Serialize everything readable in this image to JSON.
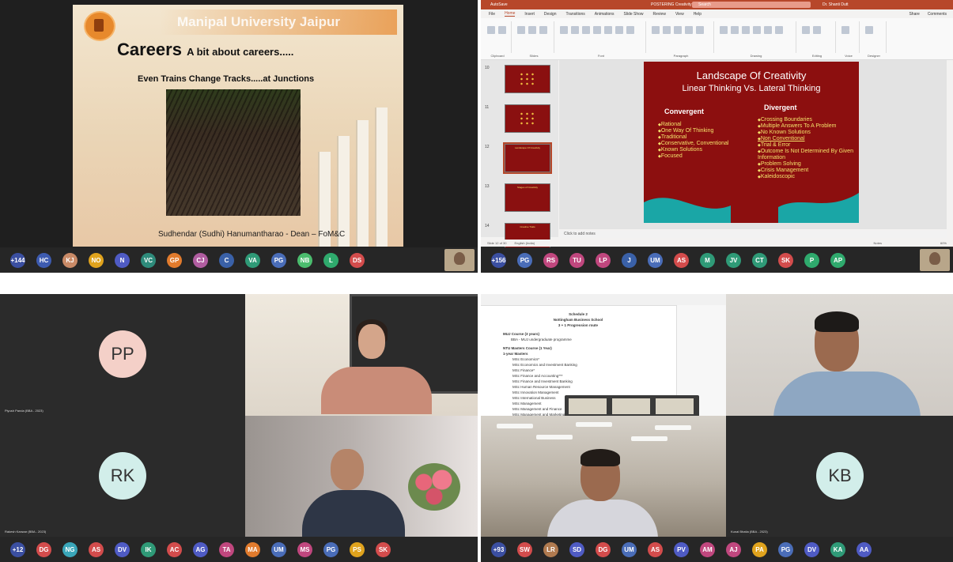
{
  "q1": {
    "slide": {
      "university": "Manipal University Jaipur",
      "careers": "Careers",
      "careers_sub": "A bit about careers.....",
      "tracks": "Even Trains Change Tracks.....at Junctions",
      "dean": "Sudhendar (Sudhi) Hanumantharao - Dean – FoM&C"
    },
    "strip": [
      {
        "initials": "+144",
        "color": "#3b4fa1"
      },
      {
        "initials": "HC",
        "color": "#3d5bb0"
      },
      {
        "initials": "KJ",
        "color": "#c98a67"
      },
      {
        "initials": "NO",
        "color": "#e0a31d"
      },
      {
        "initials": "N",
        "color": "#4f5bc4"
      },
      {
        "initials": "VC",
        "color": "#2e8b7b"
      },
      {
        "initials": "GP",
        "color": "#e17b2d"
      },
      {
        "initials": "CJ",
        "color": "#b05da0"
      },
      {
        "initials": "C",
        "color": "#3a61a8"
      },
      {
        "initials": "VA",
        "color": "#2f9a77"
      },
      {
        "initials": "PG",
        "color": "#4a6db8"
      },
      {
        "initials": "NB",
        "color": "#4bbd6e"
      },
      {
        "initials": "L",
        "color": "#2faa6d"
      },
      {
        "initials": "DS",
        "color": "#d34c4c"
      }
    ]
  },
  "q2": {
    "titlebar": {
      "autosave": "AutoSave",
      "doc": "POSTERING Creativity",
      "search": "Search",
      "user": "Dr. Shanti Dutt"
    },
    "menu": [
      "File",
      "Home",
      "Insert",
      "Design",
      "Transitions",
      "Animations",
      "Slide Show",
      "Review",
      "View",
      "Help"
    ],
    "menu_right": [
      "Share",
      "Comments"
    ],
    "ribbon_groups": [
      "Clipboard",
      "Slides",
      "Font",
      "Paragraph",
      "Drawing",
      "Editing",
      "Voice",
      "Designer"
    ],
    "thumb_numbers": [
      "10",
      "11",
      "12",
      "13",
      "14"
    ],
    "thumb_titles": [
      "",
      "",
      "Landscape Of Creativity",
      "Stages of Creativity",
      "Creative Traits"
    ],
    "slide": {
      "title": "Landscape Of Creativity",
      "subtitle": "Linear Thinking Vs. Lateral Thinking",
      "left_head": "Convergent",
      "right_head": "Divergent",
      "left": [
        "Rational",
        "One Way Of Thinking",
        "Traditional",
        "Conservative, Conventional",
        "Known Solutions",
        "Focused"
      ],
      "right": [
        "Crossing Boundaries",
        "Multiple Answers To A Problem",
        "No Known Solutions",
        "Non Conventional",
        "Trial & Error",
        "Outcome Is Not Determined By Given Information",
        "Problem Solving",
        "Crisis Management",
        "Kaleidoscopic"
      ]
    },
    "notes": "Click to add notes",
    "status_left": "Slide 12 of 30",
    "status_lang": "English (India)",
    "status_notes": "Notes",
    "zoom": "60%",
    "strip": [
      {
        "initials": "+156",
        "color": "#3b4fa1"
      },
      {
        "initials": "PG",
        "color": "#4a6db8"
      },
      {
        "initials": "RS",
        "color": "#c0477e"
      },
      {
        "initials": "TU",
        "color": "#c0477e"
      },
      {
        "initials": "LP",
        "color": "#c0477e"
      },
      {
        "initials": "J",
        "color": "#3a61a8"
      },
      {
        "initials": "UM",
        "color": "#4a6db8"
      },
      {
        "initials": "AS",
        "color": "#d34c4c"
      },
      {
        "initials": "M",
        "color": "#2f9a77"
      },
      {
        "initials": "JV",
        "color": "#2f9a77"
      },
      {
        "initials": "CT",
        "color": "#2f9a77"
      },
      {
        "initials": "SK",
        "color": "#d34c4c"
      },
      {
        "initials": "P",
        "color": "#2faa6d"
      },
      {
        "initials": "AP",
        "color": "#2faa6d"
      }
    ]
  },
  "q3": {
    "tile_pp": {
      "initials": "PP",
      "name": "Piyush Panda (BBA - 2023)"
    },
    "tile_rk": {
      "initials": "RK",
      "name": "Rakesh Kanwar (BBA - 2023)"
    },
    "strip": [
      {
        "initials": "+12",
        "color": "#3b4fa1"
      },
      {
        "initials": "DG",
        "color": "#d34c4c"
      },
      {
        "initials": "NG",
        "color": "#3aa6b9"
      },
      {
        "initials": "AS",
        "color": "#d34c4c"
      },
      {
        "initials": "DV",
        "color": "#4f5bc4"
      },
      {
        "initials": "IK",
        "color": "#2f9a77"
      },
      {
        "initials": "AC",
        "color": "#d34c4c"
      },
      {
        "initials": "AG",
        "color": "#4f5bc4"
      },
      {
        "initials": "TA",
        "color": "#c0477e"
      },
      {
        "initials": "MA",
        "color": "#e17b2d"
      },
      {
        "initials": "UM",
        "color": "#4a6db8"
      },
      {
        "initials": "MS",
        "color": "#c0477e"
      },
      {
        "initials": "PG",
        "color": "#4a6db8"
      },
      {
        "initials": "PS",
        "color": "#e0a31d"
      },
      {
        "initials": "SK",
        "color": "#d34c4c"
      }
    ]
  },
  "q4": {
    "doc": {
      "schedule": "Schedule 2",
      "school": "Nottingham Business School",
      "route": "3 + 1 Progression route",
      "mju_course": "MUJ Course (3 years)",
      "mju_item": "BBA - MUJ undergraduate programme",
      "ntu_course": "NTU Masters Course (1 Year)",
      "masters": "1-year Masters",
      "items": [
        "MSc Economics*",
        "MSc Economics and Investment Banking",
        "MSc Finance*",
        "MSc Finance and Accounting***",
        "MSc Finance and Investment Banking",
        "MSc Human Resource Management",
        "MSc Innovation Management",
        "MSc International Business",
        "MSc Management",
        "MSc Management and Finance",
        "MSc Management and Marketing"
      ]
    },
    "tile_kb": {
      "initials": "KB",
      "name": "Kunal Bhatia (BBA - 2023)"
    },
    "strip": [
      {
        "initials": "+93",
        "color": "#3b4fa1"
      },
      {
        "initials": "SW",
        "color": "#d34c4c"
      },
      {
        "initials": "LR",
        "color": "#b07a4f"
      },
      {
        "initials": "SD",
        "color": "#4f5bc4"
      },
      {
        "initials": "DG",
        "color": "#d34c4c"
      },
      {
        "initials": "UM",
        "color": "#4a6db8"
      },
      {
        "initials": "AS",
        "color": "#d34c4c"
      },
      {
        "initials": "PV",
        "color": "#4f5bc4"
      },
      {
        "initials": "AM",
        "color": "#c0477e"
      },
      {
        "initials": "AJ",
        "color": "#c0477e"
      },
      {
        "initials": "PA",
        "color": "#e0a31d"
      },
      {
        "initials": "PG",
        "color": "#4a6db8"
      },
      {
        "initials": "DV",
        "color": "#4f5bc4"
      },
      {
        "initials": "KA",
        "color": "#2f9a77"
      },
      {
        "initials": "AA",
        "color": "#4f5bc4"
      }
    ]
  }
}
